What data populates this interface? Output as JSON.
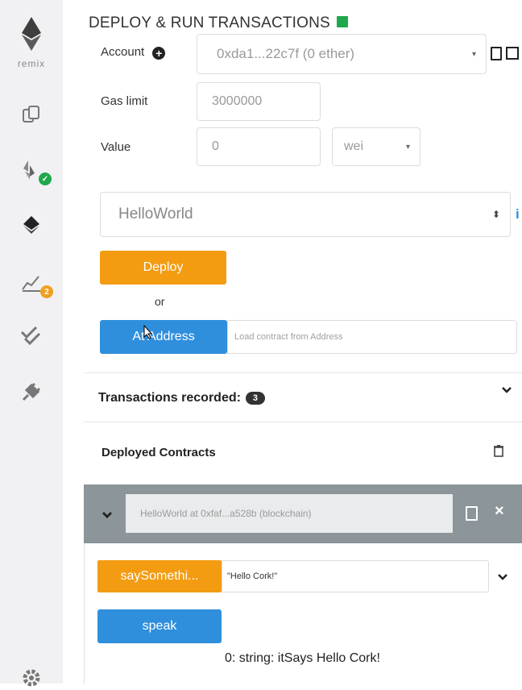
{
  "sidebar": {
    "logo_text": "remix",
    "badges": {
      "analysis_count": "2"
    }
  },
  "header": {
    "title": "DEPLOY & RUN TRANSACTIONS"
  },
  "form": {
    "account_label": "Account",
    "account_value": "0xda1...22c7f (0 ether)",
    "gas_limit_label": "Gas limit",
    "gas_limit_value": "3000000",
    "value_label": "Value",
    "value_amount": "0",
    "value_unit": "wei"
  },
  "contract": {
    "selected": "HelloWorld",
    "deploy_label": "Deploy",
    "or_label": "or",
    "at_address_label": "At Address",
    "address_placeholder": "Load contract from Address"
  },
  "transactions": {
    "label": "Transactions recorded:",
    "count": "3"
  },
  "deployed": {
    "label": "Deployed Contracts",
    "instance_label": "HelloWorld at 0xfaf...a528b (blockchain)",
    "functions": [
      {
        "name": "saySomethi...",
        "input": "\"Hello Cork!\""
      },
      {
        "name": "speak"
      }
    ],
    "result": "0: string: itSays Hello Cork!"
  },
  "colors": {
    "deploy": "#f39c12",
    "at_address": "#2f8fdc",
    "deployed_bar": "#8c9599",
    "sidebar_bg": "#f1f1f3"
  }
}
